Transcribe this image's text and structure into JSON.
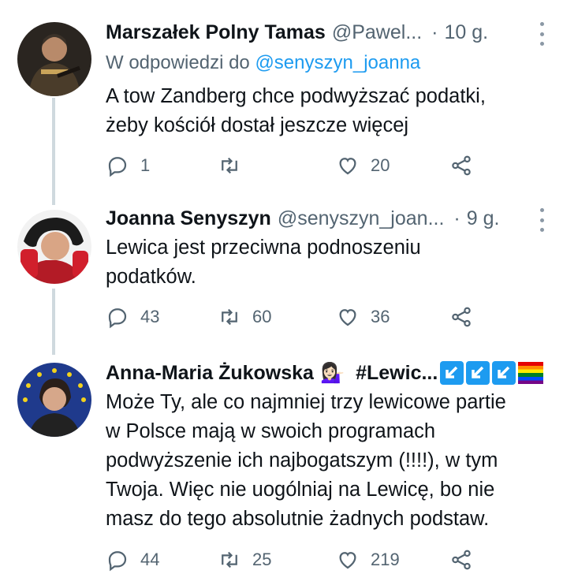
{
  "tweets": [
    {
      "name": "Marszałek Polny Tamas",
      "handle": "@Pawel...",
      "time": "10 g.",
      "reply_label": "W odpowiedzi do",
      "reply_mention": "@senyszyn_joanna",
      "text_lines": [
        "A tow Zandberg chce podwyższać podatki,",
        "żeby kościół dostał jeszcze więcej"
      ],
      "replies": "1",
      "retweets": "",
      "likes": "20"
    },
    {
      "name": "Joanna Senyszyn",
      "handle": "@senyszyn_joan...",
      "time": "9 g.",
      "text_lines": [
        "Lewica jest przeciwna podnoszeniu",
        "podatków."
      ],
      "replies": "43",
      "retweets": "60",
      "likes": "36"
    },
    {
      "name": "Anna-Maria Żukowska",
      "emoji": "💁🏻‍♀️",
      "hashtag": "#Lewic...",
      "text_lines": [
        "Może Ty, ale co najmniej trzy lewicowe partie",
        "w Polsce mają w swoich programach",
        "podwyższenie ich najbogatszym (!!!!), w tym",
        "Twoja. Więc nie uogólniaj na Lewicę, bo nie",
        "masz do tego absolutnie żadnych podstaw."
      ],
      "replies": "44",
      "retweets": "25",
      "likes": "219"
    }
  ],
  "colors": {
    "text": "#0f1419",
    "secondary": "#536471",
    "link": "#1d9bf0",
    "thread_line": "#cfd9de"
  },
  "icons": [
    "reply-icon",
    "retweet-icon",
    "like-icon",
    "share-icon",
    "more-icon"
  ]
}
